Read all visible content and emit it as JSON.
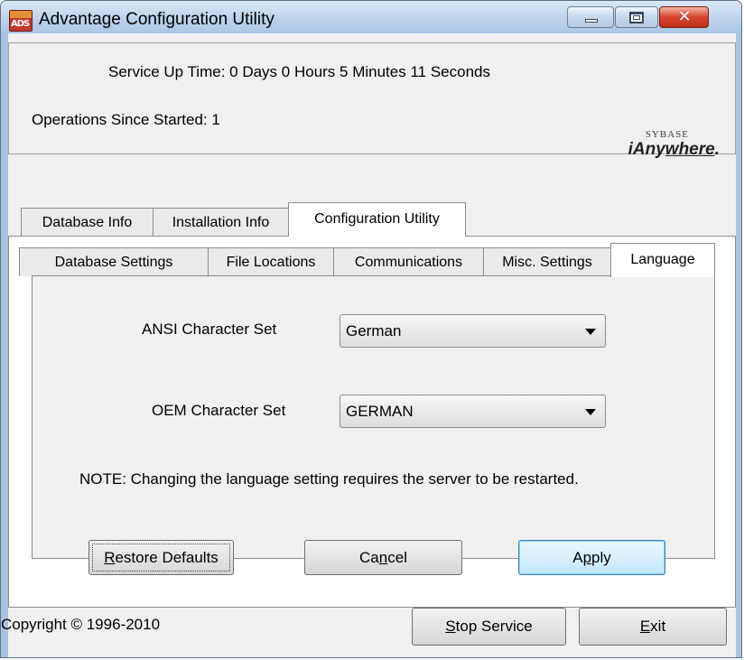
{
  "window": {
    "title": "Advantage Configuration Utility",
    "icon_text": "ADS",
    "icon_name": "ads-app-icon",
    "caption_buttons": [
      "minimize-icon",
      "maximize-icon",
      "close-icon"
    ]
  },
  "status": {
    "uptime": "Service Up Time:  0 Days 0 Hours 5 Minutes 11 Seconds",
    "operations": "Operations Since Started: 1"
  },
  "logo": {
    "top": "SYBASE",
    "bottom_prefix": "iAny",
    "bottom_underlined": "where",
    "bottom_suffix": "."
  },
  "outer_tabs": [
    {
      "label": "Database Info",
      "selected": false
    },
    {
      "label": "Installation Info",
      "selected": false
    },
    {
      "label": "Configuration Utility",
      "selected": true
    }
  ],
  "inner_tabs": [
    {
      "label": "Database Settings",
      "selected": false
    },
    {
      "label": "File Locations",
      "selected": false
    },
    {
      "label": "Communications",
      "selected": false
    },
    {
      "label": "Misc. Settings",
      "selected": false
    },
    {
      "label": "Language",
      "selected": true
    }
  ],
  "language": {
    "ansi_label": "ANSI Character Set",
    "ansi_value": "German",
    "oem_label": "OEM Character Set",
    "oem_value": "GERMAN",
    "note": "NOTE: Changing the language setting requires the server to be restarted."
  },
  "actions": {
    "restore_prefix": "",
    "restore_mnemonic": "R",
    "restore_suffix": "estore Defaults",
    "cancel_prefix": "Ca",
    "cancel_mnemonic": "n",
    "cancel_suffix": "cel",
    "apply_prefix": "A",
    "apply_mnemonic": "p",
    "apply_suffix": "ply"
  },
  "footer": {
    "copyright": "Copyright © 1996-2010",
    "stop_prefix": "",
    "stop_mnemonic": "S",
    "stop_suffix": "top Service",
    "exit_prefix": "",
    "exit_mnemonic": "E",
    "exit_suffix": "xit"
  }
}
